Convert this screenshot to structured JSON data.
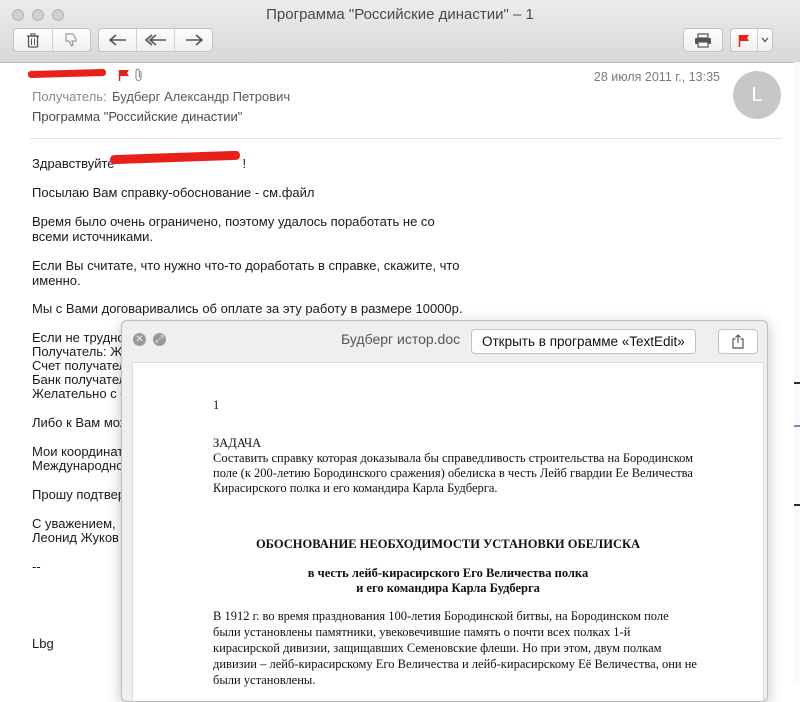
{
  "window": {
    "title": "Программа \"Российские династии\" – 1"
  },
  "message": {
    "date": "28 июля 2011 г., 13:35",
    "avatar_letter": "L",
    "to_label": "Получатель:",
    "to_name": "Будберг Александр Петрович",
    "subject": "Программа \"Российские династии\""
  },
  "body": {
    "greeting": "Здравствуйте",
    "greeting_end": "!",
    "p1": "Посылаю Вам справку-обоснование - см.файл",
    "p2_l1": "Время  было  очень  ограничено,  поэтому  удалось  поработать  не со",
    "p2_l2": "всеми источниками.",
    "p3_l1": "Если  Вы  считате,  что нужно что-то доработать в справке, скажите, что",
    "p3_l2": "именно.",
    "p4": "Мы  с  Вами  договаривались  об оплате за эту работу в размере 10000р.",
    "p5_l1": "Если не трудно",
    "p5_l2": "Получатель: Жу",
    "p5_l3": "Счет получател",
    "p5_l4": "Банк получател",
    "p5_l5": "Желательно с о",
    "p6": "Либо к Вам мож",
    "p7_l1": "Мои координат",
    "p7_l2": "Международно",
    "p8": "Прошу подтвер",
    "sign_l1": "С уважением,",
    "sign_l2": "Леонид Жуков",
    "dashes": "--",
    "footer": "Lbg"
  },
  "quicklook": {
    "title": "Будберг истор.doc",
    "open_button": "Открыть в программе «TextEdit»",
    "page_number": "1",
    "task_heading": "ЗАДАЧА",
    "task_l1": "Составить справку которая доказывала бы справедливость строительства на Бородинском",
    "task_l2": "поле (к 200-летию Бородинского сражения) обелиска в честь Лейб гвардии Ее Величества",
    "task_l3": "Кирасирского полка и его командира Карла Будберга.",
    "heading": "ОБОСНОВАНИЕ НЕОБХОДИМОСТИ УСТАНОВКИ ОБЕЛИСКА",
    "subheading_l1": "в честь лейб-кирасирского Его Величества полка",
    "subheading_l2": "и его командира Карла Будберга",
    "para_l1": "В 1912 г. во время празднования 100-летия Бородинской битвы, на Бородинском поле",
    "para_l2": "были установлены памятники, увековечившие память о почти всех полках 1-й",
    "para_l3": "кирасирской дивизии, защищавших Семеновские флеши. Но при этом, двум полкам",
    "para_l4": "дивизии – лейб-кирасирскому Его Величества и лейб-кирасирскому Её Величества, они не",
    "para_l5": "были установлены."
  },
  "colors": {
    "flag_red": "#e8201a",
    "toolbar_bg": "#e3e3e3"
  }
}
